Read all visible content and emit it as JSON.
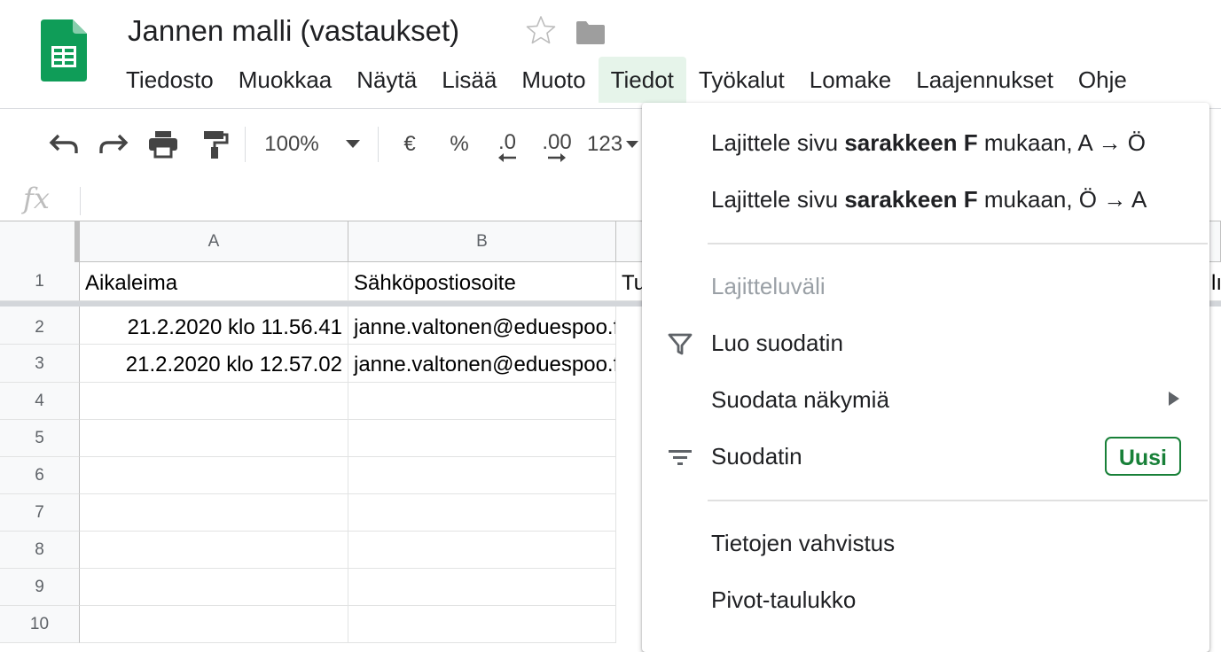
{
  "app": {
    "doc_title": "Jannen malli (vastaukset)",
    "colors": {
      "sheets_green": "#0f9d58",
      "menu_active_bg": "#e6f4ea",
      "badge_green": "#188038"
    }
  },
  "menubar": {
    "items": [
      "Tiedosto",
      "Muokkaa",
      "Näytä",
      "Lisää",
      "Muoto",
      "Tiedot",
      "Työkalut",
      "Lomake",
      "Laajennukset",
      "Ohje"
    ],
    "active": "Tiedot"
  },
  "toolbar": {
    "zoom": "100%",
    "currency": "€",
    "percent": "%",
    "decrease_decimals": ".0",
    "increase_decimals": ".00",
    "more_formats": "123",
    "icons": [
      "undo-icon",
      "redo-icon",
      "print-icon",
      "paint-format-icon",
      "chevron-down-icon"
    ]
  },
  "formula_bar": {
    "fx": "fx",
    "value": ""
  },
  "sheet": {
    "columns": [
      "A",
      "B"
    ],
    "rows": [
      {
        "num": "1",
        "a": "Aikaleima",
        "b": "Sähköpostiosoite",
        "c": "Tu",
        "edge": "lı"
      },
      {
        "num": "2",
        "a": "21.2.2020 klo 11.56.41",
        "b": "janne.valtonen@eduespoo.fi"
      },
      {
        "num": "3",
        "a": "21.2.2020 klo 12.57.02",
        "b": "janne.valtonen@eduespoo.fi"
      },
      {
        "num": "4"
      },
      {
        "num": "5"
      },
      {
        "num": "6"
      },
      {
        "num": "7"
      },
      {
        "num": "8"
      },
      {
        "num": "9"
      },
      {
        "num": "10"
      }
    ]
  },
  "data_menu": {
    "sort_az": {
      "prefix": "Lajittele sivu ",
      "bold": "sarakkeen F",
      "suffix": " mukaan, A → Ö"
    },
    "sort_za": {
      "prefix": "Lajittele sivu ",
      "bold": "sarakkeen F",
      "suffix": " mukaan, Ö → A"
    },
    "sort_range": "Lajitteluväli",
    "create_filter": "Luo suodatin",
    "filter_views": "Suodata näkymiä",
    "slicer": "Suodatin",
    "slicer_badge": "Uusi",
    "data_validation": "Tietojen vahvistus",
    "pivot_table": "Pivot-taulukko"
  }
}
